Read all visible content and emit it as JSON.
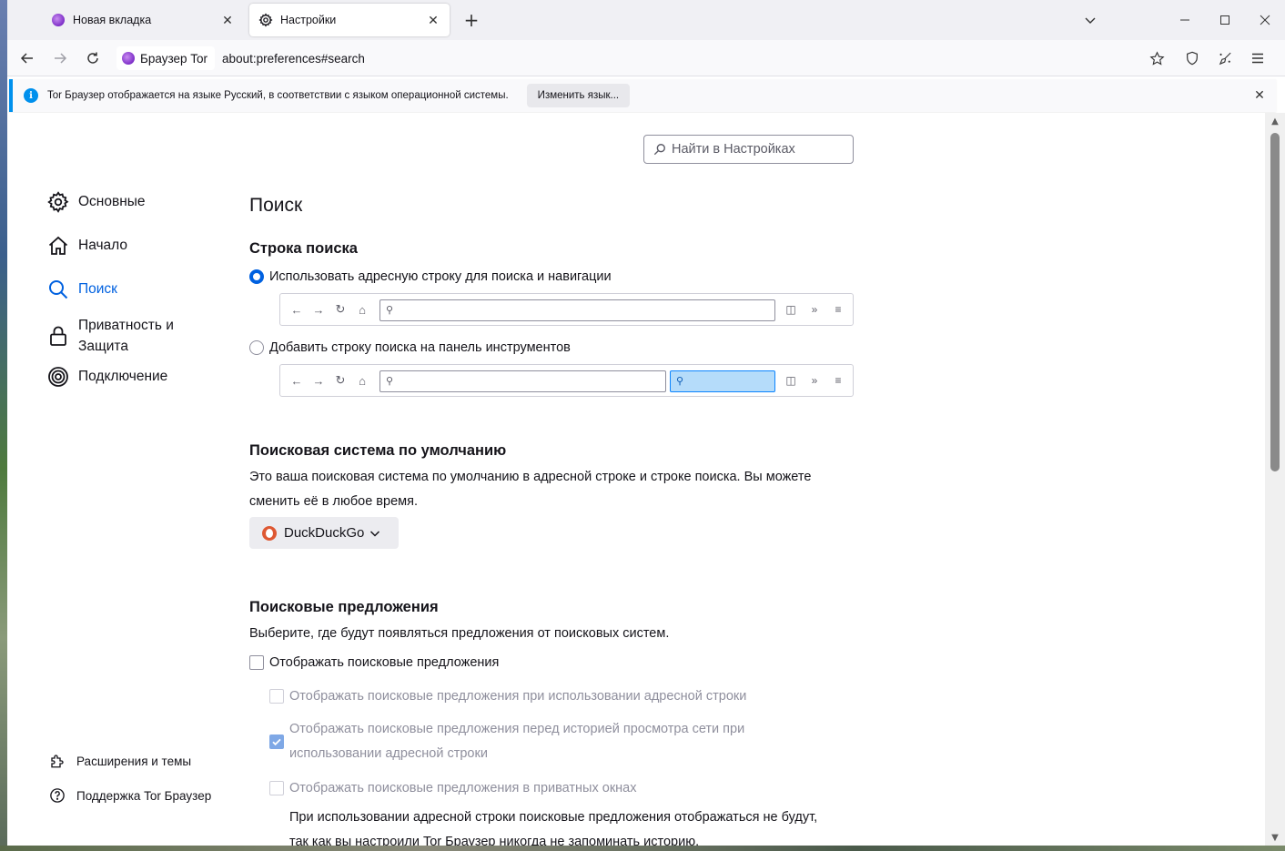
{
  "tabs": [
    {
      "label": "Новая вкладка"
    },
    {
      "label": "Настройки"
    }
  ],
  "navbar": {
    "identity_label": "Браузер Tor",
    "url": "about:preferences#search"
  },
  "notification": {
    "text": "Tor Браузер отображается на языке Русский, в соответствии с языком операционной системы.",
    "button": "Изменить язык..."
  },
  "search_prefs": {
    "placeholder": "Найти в Настройках"
  },
  "sidebar": {
    "items": [
      {
        "label": "Основные"
      },
      {
        "label": "Начало"
      },
      {
        "label": "Поиск"
      },
      {
        "label": "Приватность и Защита"
      },
      {
        "label": "Подключение"
      }
    ],
    "footer": [
      {
        "label": "Расширения и темы"
      },
      {
        "label": "Поддержка Tor Браузер"
      }
    ]
  },
  "main": {
    "title": "Поиск",
    "search_bar": {
      "heading": "Строка поиска",
      "option_urlbar": "Использовать адресную строку для поиска и навигации",
      "option_searchbar": "Добавить строку поиска на панель инструментов"
    },
    "default_engine": {
      "heading": "Поисковая система по умолчанию",
      "description_line1": "Это ваша поисковая система по умолчанию в адресной строке и строке поиска. Вы можете",
      "description_line2": "сменить её в любое время.",
      "engine": "DuckDuckGo"
    },
    "suggestions": {
      "heading": "Поисковые предложения",
      "description": "Выберите, где будут появляться предложения от поисковых систем.",
      "show_suggestions": "Отображать поисковые предложения",
      "in_urlbar": "Отображать поисковые предложения при использовании адресной строки",
      "before_history_line1": "Отображать поисковые предложения перед историей просмотра сети при",
      "before_history_line2": "использовании адресной строки",
      "in_private": "Отображать поисковые предложения в приватных окнах",
      "note_line1": "При использовании адресной строки поисковые предложения отображаться не будут,",
      "note_line2": "так как вы настроили Tor Браузер никогда не запоминать историю."
    }
  },
  "colors": {
    "accent": "#0061e0",
    "notification_border": "#0090ed",
    "tor_purple": "#7d2ec8",
    "ddg_orange": "#de5833"
  }
}
